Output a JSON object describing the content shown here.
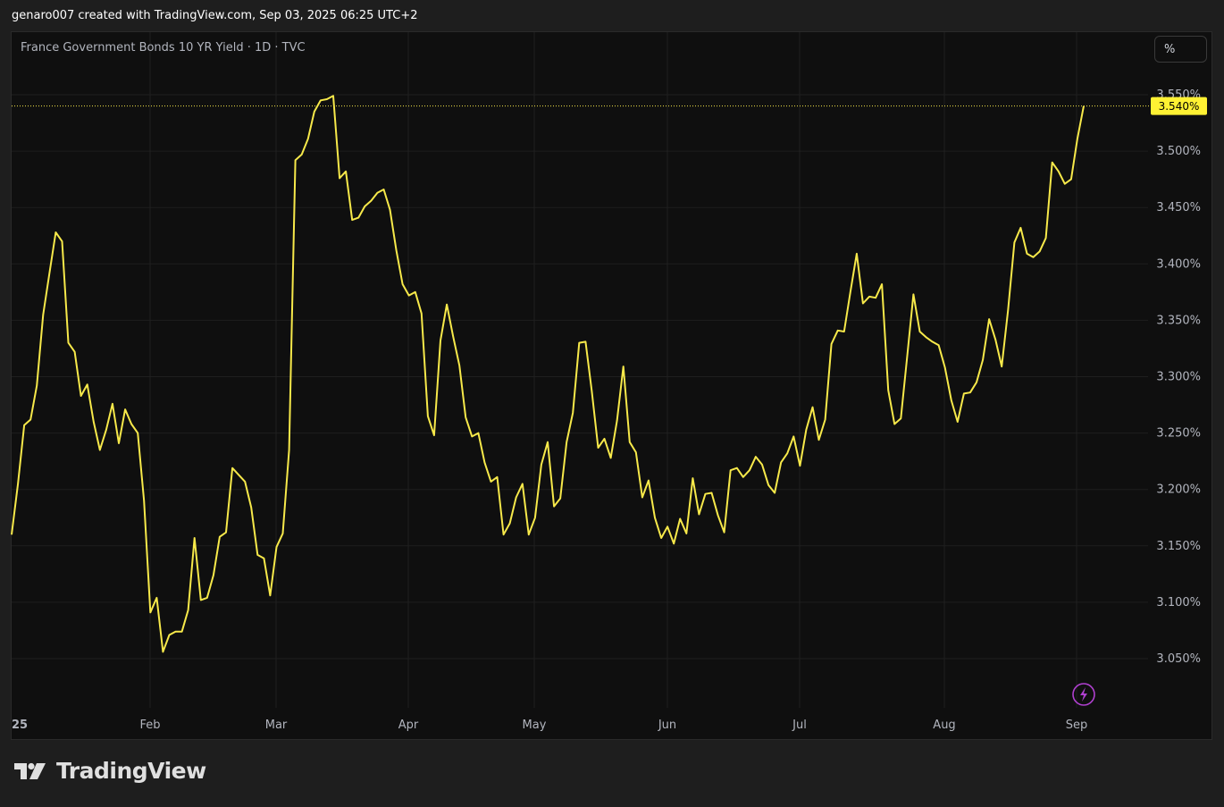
{
  "header": {
    "caption": "genaro007 created with TradingView.com, Sep 03, 2025 06:25 UTC+2"
  },
  "chart_title": "France Government Bonds 10 YR Yield · 1D · TVC",
  "scale_button": "%",
  "brand": {
    "name": "TradingView"
  },
  "colors": {
    "line": "#f7e94a",
    "last_label_bg": "#fff133",
    "grid": "#1f1f1f",
    "background": "#0f0f0f",
    "lightning": "#b040d0"
  },
  "chart_data": {
    "type": "line",
    "title": "France Government Bonds 10 YR Yield · 1D · TVC",
    "xlabel": "",
    "ylabel": "",
    "x_tick_labels": [
      "25",
      "Feb",
      "Mar",
      "Apr",
      "May",
      "Jun",
      "Jul",
      "Aug",
      "Sep"
    ],
    "y_tick_labels": [
      "3.050%",
      "3.100%",
      "3.150%",
      "3.200%",
      "3.250%",
      "3.300%",
      "3.350%",
      "3.400%",
      "3.450%",
      "3.500%",
      "3.550%"
    ],
    "ylim": [
      3.01,
      3.57
    ],
    "last_value_label": "3.540%",
    "last_value": 3.54,
    "grid": true,
    "series": [
      {
        "values": [
          3.16,
          3.205,
          3.257,
          3.262,
          3.292,
          3.355,
          3.392,
          3.428,
          3.42,
          3.33,
          3.322,
          3.283,
          3.293,
          3.26,
          3.235,
          3.253,
          3.276,
          3.241,
          3.271,
          3.258,
          3.25,
          3.19,
          3.091,
          3.104,
          3.056,
          3.071,
          3.074,
          3.074,
          3.093,
          3.157,
          3.102,
          3.104,
          3.124,
          3.158,
          3.162,
          3.219,
          3.213,
          3.207,
          3.184,
          3.142,
          3.139,
          3.106,
          3.149,
          3.161,
          3.235,
          3.492,
          3.497,
          3.511,
          3.535,
          3.545,
          3.546,
          3.549,
          3.476,
          3.482,
          3.439,
          3.441,
          3.451,
          3.456,
          3.463,
          3.466,
          3.448,
          3.412,
          3.382,
          3.372,
          3.375,
          3.356,
          3.265,
          3.248,
          3.332,
          3.364,
          3.336,
          3.31,
          3.264,
          3.247,
          3.25,
          3.224,
          3.207,
          3.211,
          3.16,
          3.17,
          3.193,
          3.205,
          3.16,
          3.175,
          3.222,
          3.242,
          3.185,
          3.192,
          3.242,
          3.268,
          3.33,
          3.331,
          3.287,
          3.237,
          3.245,
          3.228,
          3.261,
          3.309,
          3.242,
          3.233,
          3.193,
          3.208,
          3.175,
          3.157,
          3.167,
          3.152,
          3.174,
          3.161,
          3.21,
          3.178,
          3.196,
          3.197,
          3.177,
          3.162,
          3.217,
          3.219,
          3.211,
          3.217,
          3.229,
          3.222,
          3.204,
          3.197,
          3.224,
          3.232,
          3.247,
          3.221,
          3.253,
          3.273,
          3.244,
          3.262,
          3.329,
          3.341,
          3.34,
          3.375,
          3.409,
          3.365,
          3.371,
          3.37,
          3.382,
          3.288,
          3.258,
          3.263,
          3.318,
          3.373,
          3.34,
          3.335,
          3.331,
          3.328,
          3.308,
          3.279,
          3.26,
          3.285,
          3.286,
          3.295,
          3.315,
          3.351,
          3.333,
          3.309,
          3.359,
          3.419,
          3.432,
          3.409,
          3.406,
          3.411,
          3.423,
          3.49,
          3.482,
          3.471,
          3.475,
          3.511,
          3.54
        ]
      }
    ]
  }
}
